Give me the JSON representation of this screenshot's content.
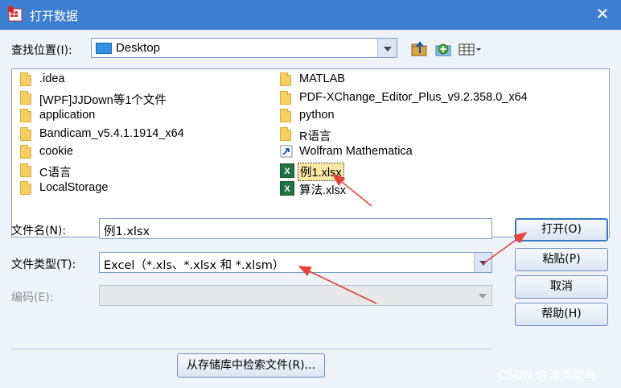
{
  "window": {
    "title": "打开数据",
    "close_glyph": "✕"
  },
  "lookin": {
    "label": "查找位置(I):",
    "value": "Desktop",
    "toolbar_icons": [
      "up-folder-icon",
      "new-folder-icon",
      "view-menu-icon"
    ]
  },
  "files": {
    "left": [
      {
        "name": ".idea",
        "type": "folder"
      },
      {
        "name": "[WPF]JJDown等1个文件",
        "type": "folder"
      },
      {
        "name": "application",
        "type": "folder"
      },
      {
        "name": "Bandicam_v5.4.1.1914_x64",
        "type": "folder"
      },
      {
        "name": "cookie",
        "type": "folder"
      },
      {
        "name": "C语言",
        "type": "folder"
      },
      {
        "name": "LocalStorage",
        "type": "folder"
      }
    ],
    "right": [
      {
        "name": "MATLAB",
        "type": "folder"
      },
      {
        "name": "PDF-XChange_Editor_Plus_v9.2.358.0_x64",
        "type": "folder"
      },
      {
        "name": "python",
        "type": "folder"
      },
      {
        "name": "R语言",
        "type": "folder"
      },
      {
        "name": "Wolfram Mathematica",
        "type": "shortcut"
      },
      {
        "name": "例1.xlsx",
        "type": "excel",
        "selected": true
      },
      {
        "name": "算法.xlsx",
        "type": "excel"
      }
    ]
  },
  "filename": {
    "label": "文件名(N):",
    "value": "例1.xlsx"
  },
  "filetype": {
    "label": "文件类型(T):",
    "value": "Excel（*.xls、*.xlsx 和 *.xlsm）"
  },
  "encoding": {
    "label": "编码(E):",
    "value": ""
  },
  "buttons": {
    "open": "打开(O)",
    "paste": "粘贴(P)",
    "cancel": "取消",
    "help": "帮助(H)",
    "search_repo": "从存储库中检索文件(R)..."
  },
  "watermark": "CSDN @洋洋菜鸟",
  "colors": {
    "titlebar": "#3c7fd1",
    "client": "#eef3fa",
    "annotation_arrow": "#e8413a",
    "excel_icon": "#1f7244",
    "folder_icon": "#f6cf63"
  }
}
